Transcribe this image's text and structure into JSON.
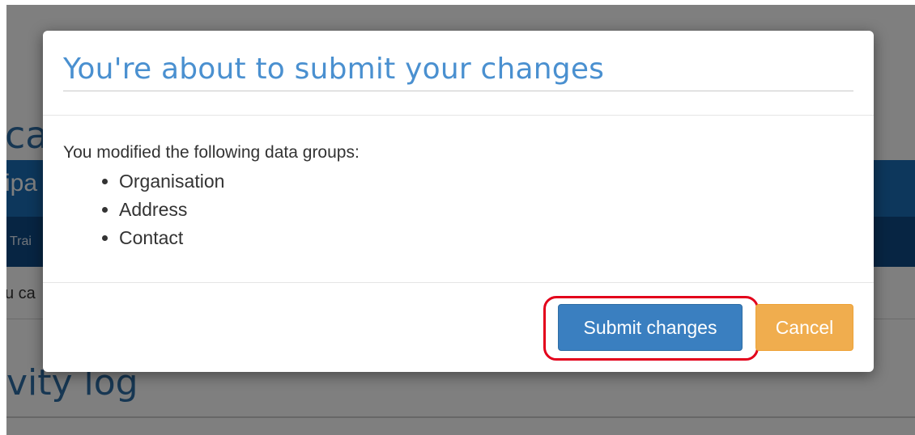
{
  "background": {
    "heading_fragment": "ca",
    "blue_bar_fragment": "ipa",
    "dark_bar_fragment": "Trai",
    "text_fragment": "u ca",
    "log_heading_fragment": "vity log"
  },
  "modal": {
    "title": "You're about to submit your changes",
    "intro": "You modified the following data groups:",
    "groups": [
      "Organisation",
      "Address",
      "Contact"
    ],
    "submit_label": "Submit changes",
    "cancel_label": "Cancel"
  },
  "colors": {
    "title": "#4a90d0",
    "submit_button": "#3a7fc0",
    "cancel_button": "#f0ad4e",
    "highlight_ring": "#e3001b"
  }
}
